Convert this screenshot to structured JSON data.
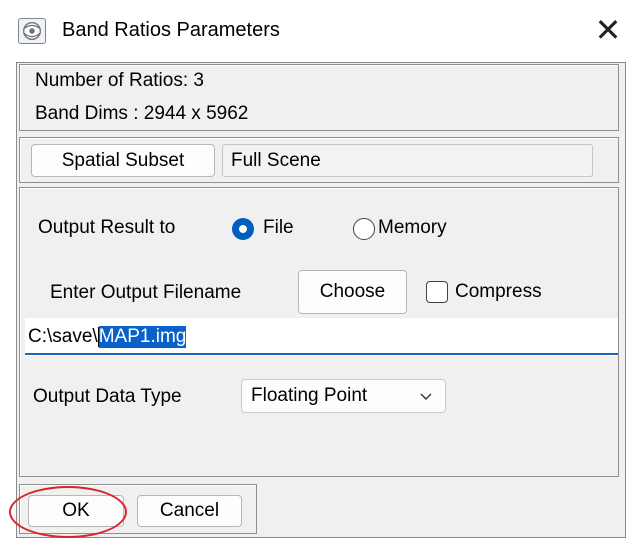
{
  "window": {
    "title": "Band Ratios Parameters",
    "icon": "app-icon",
    "close_glyph": "✕"
  },
  "info": {
    "num_ratios": "Number of Ratios: 3",
    "band_dims": "Band Dims : 2944 x 5962"
  },
  "spatial_subset": {
    "button_label": "Spatial Subset",
    "value": "Full Scene"
  },
  "output": {
    "result_to_label": "Output Result to",
    "options": [
      {
        "label": "File",
        "selected": true
      },
      {
        "label": "Memory",
        "selected": false
      }
    ],
    "filename_label": "Enter Output Filename",
    "choose_label": "Choose",
    "compress_label": "Compress",
    "compress_checked": false,
    "filename_prefix": "C:\\save\\",
    "filename_selected": "MAP1.img",
    "data_type_label": "Output Data Type",
    "data_type_value": "Floating Point"
  },
  "buttons": {
    "ok": "OK",
    "cancel": "Cancel"
  },
  "annotation": {
    "highlight": "red circle around OK button",
    "color": "#d9262c"
  },
  "colors": {
    "accent": "#0060c0",
    "selection": "#0a61c9",
    "background": "#f0f0f0"
  }
}
